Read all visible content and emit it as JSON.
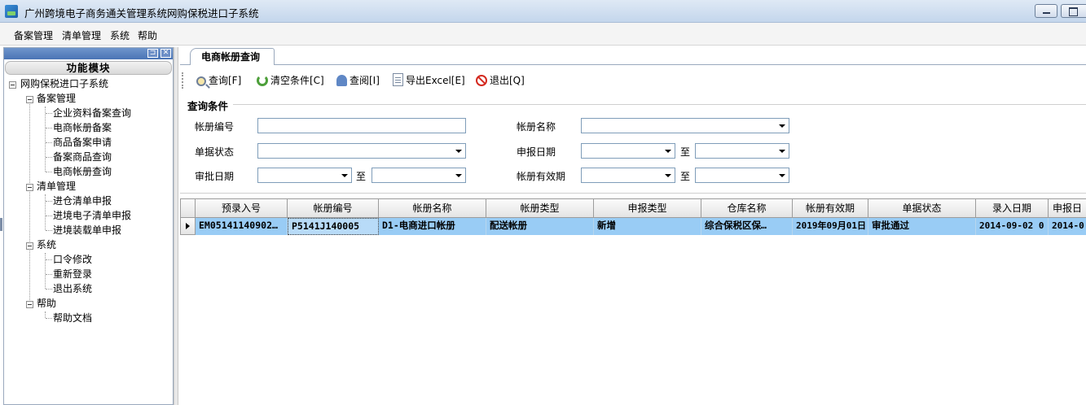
{
  "window": {
    "title": "广州跨境电子商务通关管理系统网购保税进口子系统"
  },
  "menu": [
    "备案管理",
    "清单管理",
    "系统",
    "帮助"
  ],
  "left_panel": {
    "header": "功能模块",
    "root": "网购保税进口子系统",
    "groups": [
      {
        "label": "备案管理",
        "items": [
          "企业资料备案查询",
          "电商帐册备案",
          "商品备案申请",
          "备案商品查询",
          "电商帐册查询"
        ]
      },
      {
        "label": "清单管理",
        "items": [
          "进仓清单申报",
          "进境电子清单申报",
          "进境装载单申报"
        ]
      },
      {
        "label": "系统",
        "items": [
          "口令修改",
          "重新登录",
          "退出系统"
        ]
      },
      {
        "label": "帮助",
        "items": [
          "帮助文档"
        ]
      }
    ]
  },
  "tab": {
    "label": "电商帐册查询"
  },
  "toolbar": {
    "query": "查询[F]",
    "clear": "清空条件[C]",
    "view": "查阅[I]",
    "export": "导出Excel[E]",
    "exit": "退出[Q]"
  },
  "form": {
    "group_title": "查询条件",
    "book_no": "帐册编号",
    "book_name": "帐册名称",
    "doc_status": "单据状态",
    "declare_date": "申报日期",
    "approve_date": "审批日期",
    "book_validity": "帐册有效期",
    "to": "至"
  },
  "grid": {
    "columns": [
      "预录入号",
      "帐册编号",
      "帐册名称",
      "帐册类型",
      "申报类型",
      "仓库名称",
      "帐册有效期",
      "单据状态",
      "录入日期",
      "申报日"
    ],
    "rows": [
      [
        "EM05141140902…",
        "P5141J140005",
        "D1-电商进口帐册",
        "配送帐册",
        "新增",
        "综合保税区保…",
        "2019年09月01日",
        "审批通过",
        "2014-09-02 0",
        "2014-0"
      ]
    ]
  }
}
